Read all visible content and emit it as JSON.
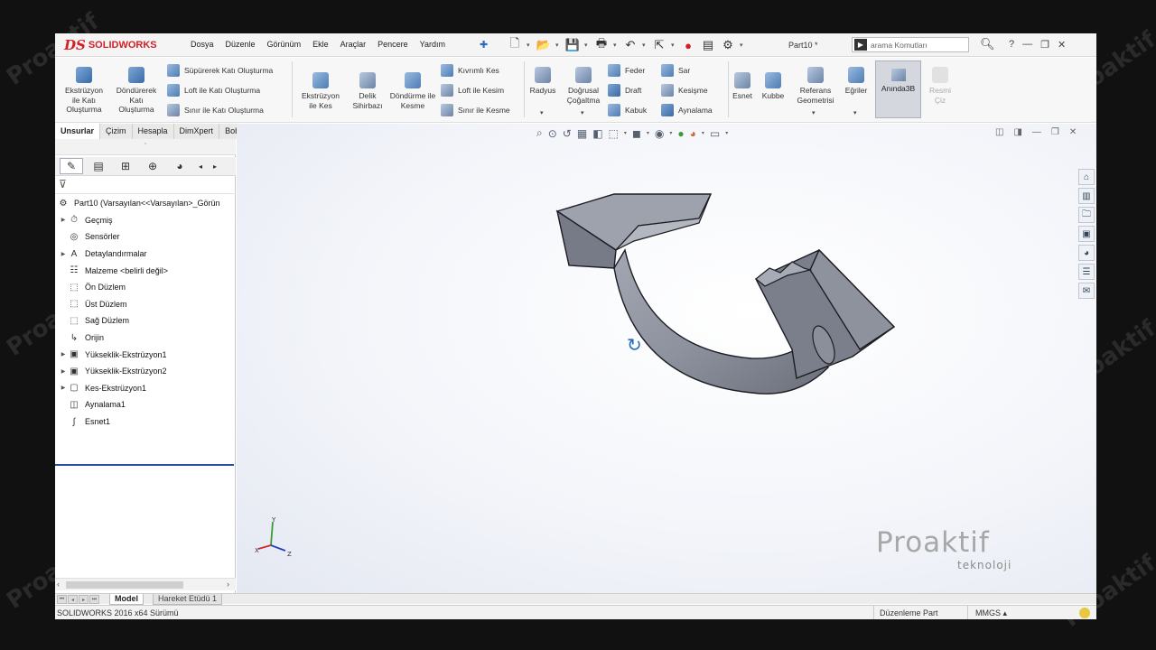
{
  "app": {
    "logo_ds": "DS",
    "logo_text": "SOLIDWORKS",
    "document_title": "Part10 *",
    "search_placeholder": "arama Komutları"
  },
  "menu": [
    "Dosya",
    "Düzenle",
    "Görünüm",
    "Ekle",
    "Araçlar",
    "Pencere",
    "Yardım"
  ],
  "commands": {
    "extrude_boss": "Ekstrüzyon ile Katı Oluşturma",
    "revolve_boss": "Döndürerek Katı Oluşturma",
    "sweep_boss": "Süpürerek Katı Oluşturma",
    "loft_boss": "Loft ile Katı Oluşturma",
    "boundary_boss": "Sınır ile Katı Oluşturma",
    "extrude_cut": "Ekstrüzyon ile Kes",
    "hole_wizard": "Delik Sihirbazı",
    "revolve_cut": "Döndürme ile Kesme",
    "swept_cut": "Kıvrımlı Kes",
    "loft_cut": "Loft ile Kesim",
    "boundary_cut": "Sınır ile Kesme",
    "fillet": "Radyus",
    "linear_pattern": "Doğrusal Çoğaltma",
    "rib": "Feder",
    "draft": "Draft",
    "shell": "Kabuk",
    "wrap": "Sar",
    "intersect": "Kesişme",
    "mirror": "Aynalama",
    "flex": "Esnet",
    "dome": "Kubbe",
    "reference_geometry": "Referans Geometrisi",
    "curves": "Eğriler",
    "instant3d": "Anında3B",
    "sketch_picture": "Resmi Çiz"
  },
  "cm_tabs": [
    "Unsurlar",
    "Çizim",
    "Hesapla",
    "DimXpert",
    "BobCAM"
  ],
  "feature_tree": {
    "root": "Part10  (Varsayılan<<Varsayılan>_Görün",
    "items": [
      {
        "label": "Geçmiş",
        "expandable": true,
        "icon": "history-icon"
      },
      {
        "label": "Sensörler",
        "expandable": false,
        "icon": "sensor-icon"
      },
      {
        "label": "Detaylandırmalar",
        "expandable": true,
        "icon": "annotations-icon"
      },
      {
        "label": "Malzeme <belirli değil>",
        "expandable": false,
        "icon": "material-icon"
      },
      {
        "label": "Ön Düzlem",
        "expandable": false,
        "icon": "plane-icon"
      },
      {
        "label": "Üst Düzlem",
        "expandable": false,
        "icon": "plane-icon"
      },
      {
        "label": "Sağ Düzlem",
        "expandable": false,
        "icon": "plane-icon"
      },
      {
        "label": "Orijin",
        "expandable": false,
        "icon": "origin-icon"
      },
      {
        "label": "Yükseklik-Ekstrüzyon1",
        "expandable": true,
        "icon": "boss-extrude-icon"
      },
      {
        "label": "Yükseklik-Ekstrüzyon2",
        "expandable": true,
        "icon": "boss-extrude-icon"
      },
      {
        "label": "Kes-Ekstrüzyon1",
        "expandable": true,
        "icon": "cut-extrude-icon"
      },
      {
        "label": "Aynalama1",
        "expandable": false,
        "icon": "mirror-icon"
      },
      {
        "label": "Esnet1",
        "expandable": false,
        "icon": "flex-icon"
      }
    ]
  },
  "model_tabs": [
    "Model",
    "Hareket Etüdü 1"
  ],
  "status": {
    "version": "SOLIDWORKS 2016 x64 Sürümü",
    "mode": "Düzenleme Part",
    "units": "MMGS"
  },
  "triad": {
    "x": "X",
    "y": "Y",
    "z": "Z"
  },
  "watermark": {
    "name": "Proaktif",
    "sub": "teknoloji"
  },
  "colors": {
    "brand_red": "#d32027",
    "model_gray": "#8a8f9c",
    "rollback_bar": "#2b4fa6"
  }
}
